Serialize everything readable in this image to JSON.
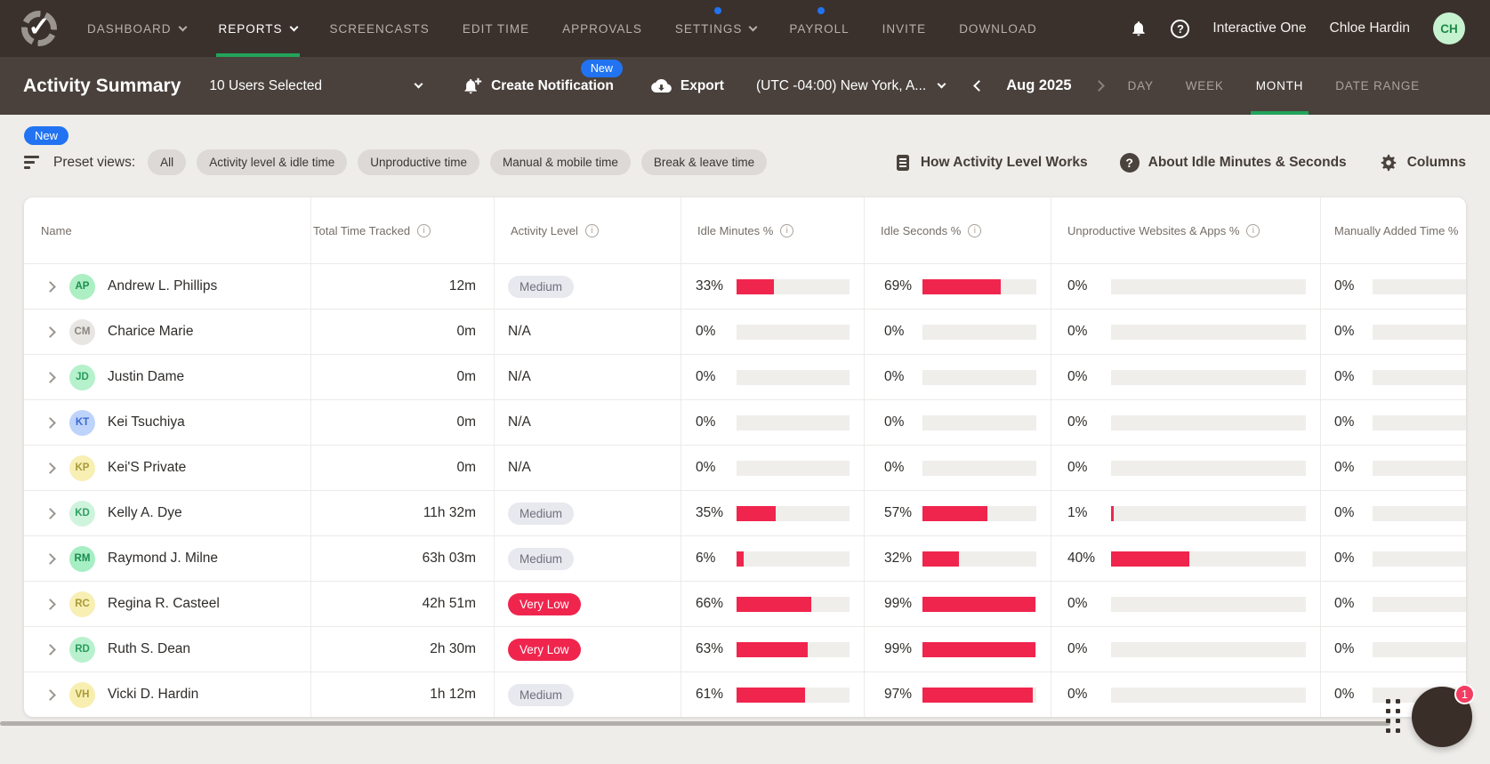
{
  "colors": {
    "green": "#22A45B",
    "blue": "#2273F2",
    "red": "#F0254E"
  },
  "topnav": {
    "items": [
      {
        "label": "DASHBOARD",
        "caret": true,
        "active": false,
        "dot": false
      },
      {
        "label": "REPORTS",
        "caret": true,
        "active": true,
        "dot": false
      },
      {
        "label": "SCREENCASTS",
        "caret": false,
        "active": false,
        "dot": false
      },
      {
        "label": "EDIT TIME",
        "caret": false,
        "active": false,
        "dot": false
      },
      {
        "label": "APPROVALS",
        "caret": false,
        "active": false,
        "dot": false
      },
      {
        "label": "SETTINGS",
        "caret": true,
        "active": false,
        "dot": true
      },
      {
        "label": "PAYROLL",
        "caret": false,
        "active": false,
        "dot": true
      },
      {
        "label": "INVITE",
        "caret": false,
        "active": false,
        "dot": false
      },
      {
        "label": "DOWNLOAD",
        "caret": false,
        "active": false,
        "dot": false
      }
    ],
    "company": "Interactive One",
    "user": "Chloe Hardin",
    "avatar_initials": "CH"
  },
  "toolbar": {
    "title": "Activity Summary",
    "users_selected": "10 Users Selected",
    "new_badge": "New",
    "create_notification": "Create Notification",
    "export_label": "Export",
    "timezone": "(UTC -04:00) New York, A...",
    "period": "Aug 2025",
    "tabs": [
      {
        "label": "DAY",
        "active": false
      },
      {
        "label": "WEEK",
        "active": false
      },
      {
        "label": "MONTH",
        "active": true
      },
      {
        "label": "DATE RANGE",
        "active": false
      }
    ]
  },
  "filters": {
    "new_badge": "New",
    "preset_label": "Preset views:",
    "chips": [
      "All",
      "Activity level & idle time",
      "Unproductive time",
      "Manual & mobile time",
      "Break & leave time"
    ],
    "help_links": [
      {
        "label": "How Activity Level Works",
        "icon": "document-icon"
      },
      {
        "label": "About Idle Minutes & Seconds",
        "icon": "help-filled-icon"
      },
      {
        "label": "Columns",
        "icon": "gear-icon"
      }
    ]
  },
  "table": {
    "columns": [
      {
        "label": "Name",
        "info": false
      },
      {
        "label": "Total Time Tracked",
        "info": true
      },
      {
        "label": "Activity Level",
        "info": true
      },
      {
        "label": "Idle Minutes %",
        "info": true
      },
      {
        "label": "Idle Seconds %",
        "info": true
      },
      {
        "label": "Unproductive Websites & Apps %",
        "info": true
      },
      {
        "label": "Manually Added Time %",
        "info": false
      }
    ],
    "rows": [
      {
        "name": "Andrew L. Phillips",
        "initials": "AP",
        "avatar_bg": "#ACEFC3",
        "avatar_fg": "#1E8E4F",
        "time": "12m",
        "level": "Medium",
        "level_type": "medium",
        "idle_minutes_pct": 33,
        "idle_seconds_pct": 69,
        "unproductive_pct": 0,
        "manual_pct": 0
      },
      {
        "name": "Charice Marie",
        "initials": "CM",
        "avatar_bg": "#E8E6E3",
        "avatar_fg": "#8B857E",
        "time": "0m",
        "level": "N/A",
        "level_type": "na",
        "idle_minutes_pct": 0,
        "idle_seconds_pct": 0,
        "unproductive_pct": 0,
        "manual_pct": 0
      },
      {
        "name": "Justin Dame",
        "initials": "JD",
        "avatar_bg": "#B5F1CB",
        "avatar_fg": "#2A9B5D",
        "time": "0m",
        "level": "N/A",
        "level_type": "na",
        "idle_minutes_pct": 0,
        "idle_seconds_pct": 0,
        "unproductive_pct": 0,
        "manual_pct": 0
      },
      {
        "name": "Kei Tsuchiya",
        "initials": "KT",
        "avatar_bg": "#BDD3FA",
        "avatar_fg": "#3A6AD0",
        "time": "0m",
        "level": "N/A",
        "level_type": "na",
        "idle_minutes_pct": 0,
        "idle_seconds_pct": 0,
        "unproductive_pct": 0,
        "manual_pct": 0
      },
      {
        "name": "Kei'S Private",
        "initials": "KP",
        "avatar_bg": "#F8EFB4",
        "avatar_fg": "#A89A36",
        "time": "0m",
        "level": "N/A",
        "level_type": "na",
        "idle_minutes_pct": 0,
        "idle_seconds_pct": 0,
        "unproductive_pct": 0,
        "manual_pct": 0
      },
      {
        "name": "Kelly A. Dye",
        "initials": "KD",
        "avatar_bg": "#CFF4DE",
        "avatar_fg": "#2F9E62",
        "time": "11h 32m",
        "level": "Medium",
        "level_type": "medium",
        "idle_minutes_pct": 35,
        "idle_seconds_pct": 57,
        "unproductive_pct": 1,
        "manual_pct": 0
      },
      {
        "name": "Raymond J. Milne",
        "initials": "RM",
        "avatar_bg": "#A6EEC3",
        "avatar_fg": "#1C8C51",
        "time": "63h 03m",
        "level": "Medium",
        "level_type": "medium",
        "idle_minutes_pct": 6,
        "idle_seconds_pct": 32,
        "unproductive_pct": 40,
        "manual_pct": 0
      },
      {
        "name": "Regina R. Casteel",
        "initials": "RC",
        "avatar_bg": "#F8EFB4",
        "avatar_fg": "#A89A36",
        "time": "42h 51m",
        "level": "Very Low",
        "level_type": "very-low",
        "idle_minutes_pct": 66,
        "idle_seconds_pct": 99,
        "unproductive_pct": 0,
        "manual_pct": 0
      },
      {
        "name": "Ruth S. Dean",
        "initials": "RD",
        "avatar_bg": "#B9F1CE",
        "avatar_fg": "#2A9B5D",
        "time": "2h 30m",
        "level": "Very Low",
        "level_type": "very-low",
        "idle_minutes_pct": 63,
        "idle_seconds_pct": 99,
        "unproductive_pct": 0,
        "manual_pct": 0
      },
      {
        "name": "Vicki D. Hardin",
        "initials": "VH",
        "avatar_bg": "#F7EEB0",
        "avatar_fg": "#A89A36",
        "time": "1h 12m",
        "level": "Medium",
        "level_type": "medium",
        "idle_minutes_pct": 61,
        "idle_seconds_pct": 97,
        "unproductive_pct": 0,
        "manual_pct": 0
      }
    ]
  },
  "chat": {
    "badge_count": "1"
  }
}
